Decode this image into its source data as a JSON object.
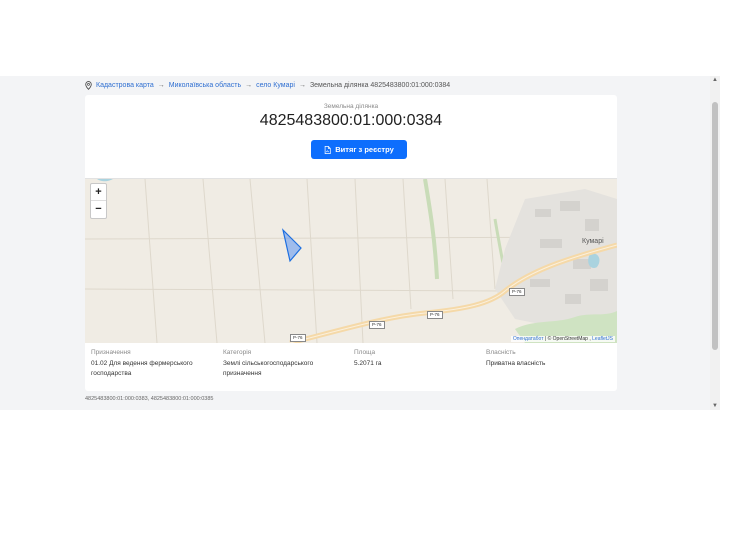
{
  "breadcrumb": {
    "items": [
      "Кадастрова карта",
      "Миколаївська область",
      "село Кумарі"
    ],
    "separator": "→",
    "current": "Земельна ділянка 4825483800:01:000:0384"
  },
  "parcel": {
    "kicker": "Земельна ділянка",
    "cadastral_number": "4825483800:01:000:0384",
    "extract_button": "Витяг з реєстру"
  },
  "map": {
    "zoom_in": "+",
    "zoom_out": "−",
    "town_label": "Кумарі",
    "road_labels": [
      "Р-76",
      "Р-76",
      "Р-76",
      "Р-76"
    ],
    "attribution": {
      "opencadastre": "Опендатабот",
      "osm": "© OpenStreetMap",
      "leaflet": "LeafletJS"
    },
    "parcel_color": "#3b82f6"
  },
  "attributes": [
    {
      "label": "Призначення",
      "value": "01.02 Для ведення фермерського господарства"
    },
    {
      "label": "Категорія",
      "value": "Землі сільськогосподарського призначення"
    },
    {
      "label": "Площа",
      "value": "5.2071 га"
    },
    {
      "label": "Власність",
      "value": "Приватна власність"
    }
  ],
  "neighbors": "4825483800:01:000:0383, 4825483800:01:000:0385",
  "scrollbar": {
    "up": "▲",
    "down": "▼"
  },
  "colors": {
    "accent": "#0d6efd",
    "link": "#2f6fd1"
  }
}
